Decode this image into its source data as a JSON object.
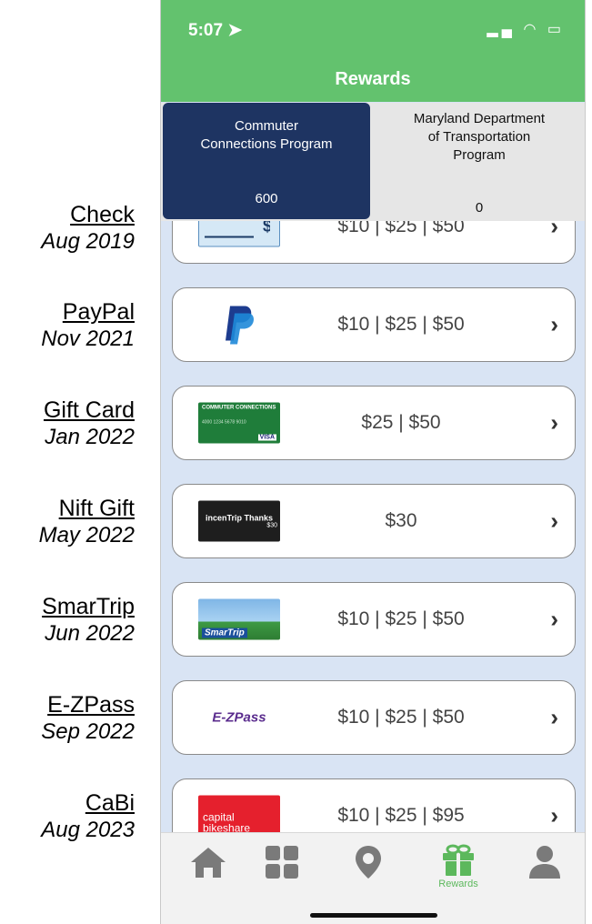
{
  "annotations": [
    {
      "name": "Check",
      "date": "Aug 2019"
    },
    {
      "name": "PayPal",
      "date": "Nov 2021"
    },
    {
      "name": "Gift Card",
      "date": "Jan 2022"
    },
    {
      "name": "Nift Gift",
      "date": "May 2022"
    },
    {
      "name": "SmarTrip",
      "date": "Jun 2022"
    },
    {
      "name": "E-ZPass",
      "date": "Sep 2022"
    },
    {
      "name": "CaBi",
      "date": "Aug 2023"
    }
  ],
  "status_bar": {
    "time": "5:07"
  },
  "header": {
    "title": "Rewards"
  },
  "program_tabs": [
    {
      "label": "Commuter Connections Program",
      "points": "600"
    },
    {
      "label": "Maryland Department of Transportation Program",
      "points": "0"
    }
  ],
  "rewards": [
    {
      "icon": "check-icon",
      "amounts": "$10 | $25 | $50"
    },
    {
      "icon": "paypal-icon",
      "amounts": "$10 | $25 | $50"
    },
    {
      "icon": "gift-card-icon",
      "amounts": "$25 | $50",
      "card_text": "COMMUTER CONNECTIONS",
      "card_number": "4000 1234 5678 9010",
      "card_brand": "VISA"
    },
    {
      "icon": "nift-icon",
      "amounts": "$30",
      "card_text": "incenTrip Thanks",
      "card_value": "$30"
    },
    {
      "icon": "smartrip-icon",
      "amounts": "$10 | $25 | $50",
      "card_text": "SmarTrip"
    },
    {
      "icon": "ezpass-icon",
      "amounts": "$10 | $25 | $50",
      "card_text": "E-ZPass"
    },
    {
      "icon": "capital-bikeshare-icon",
      "amounts": "$10 | $25 | $95",
      "card_text": "capital bikeshare"
    }
  ],
  "tab_bar": {
    "active_label": "Rewards"
  },
  "colors": {
    "header_green": "#63c26e",
    "active_tab_navy": "#1e3462",
    "list_bg": "#d9e4f4"
  }
}
